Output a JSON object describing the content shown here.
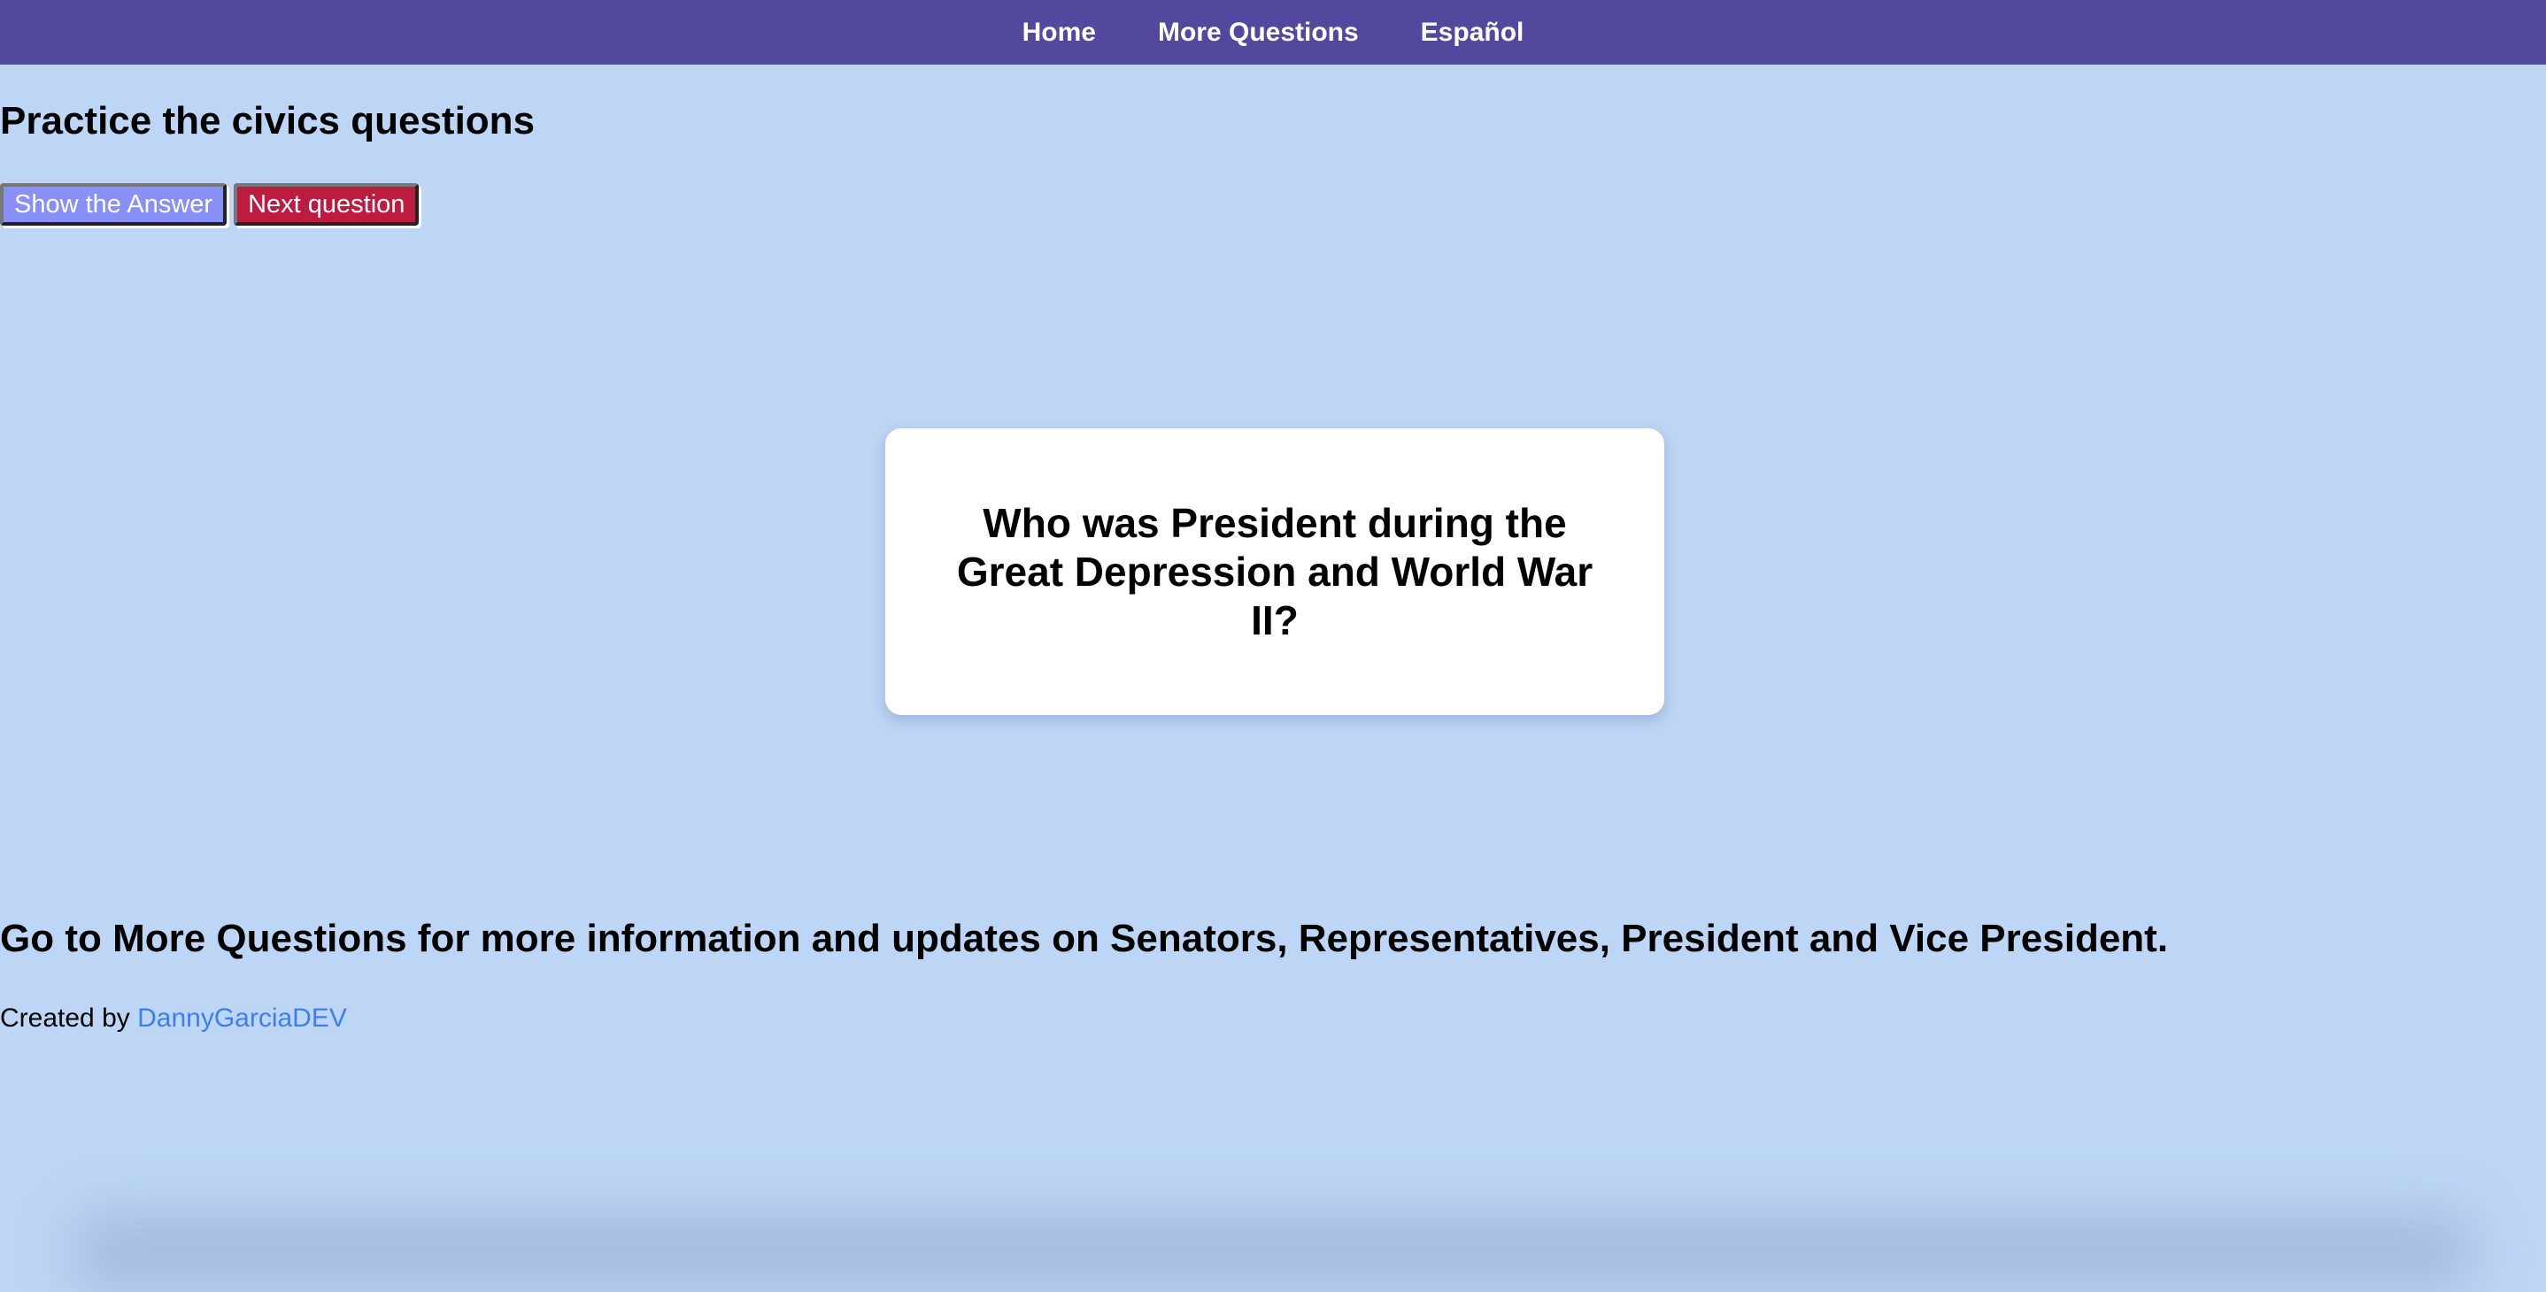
{
  "nav": {
    "items": [
      "Home",
      "More Questions",
      "Español"
    ]
  },
  "page_title": "Practice the civics questions",
  "buttons": {
    "show_answer": "Show the Answer",
    "next_question": "Next question"
  },
  "card": {
    "question": "Who was President during the Great Depression and World War II?"
  },
  "more_info": "Go to More Questions for more information and updates on Senators, Representatives, President and Vice President.",
  "footer": {
    "created_by": "Created by",
    "author": "DannyGarciaDEV"
  }
}
